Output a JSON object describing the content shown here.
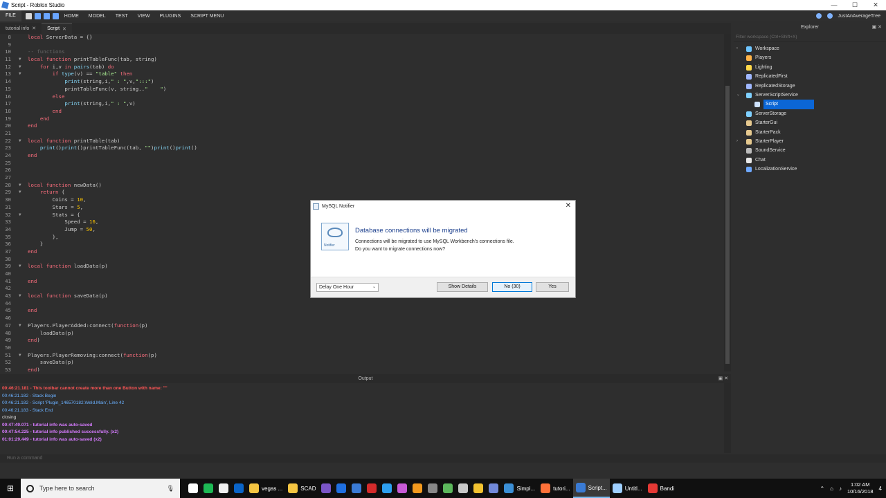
{
  "window": {
    "title": "Script - Roblox Studio"
  },
  "menu": {
    "file": "FILE",
    "tabs": [
      "HOME",
      "MODEL",
      "TEST",
      "VIEW",
      "PLUGINS",
      "SCRIPT MENU"
    ],
    "user": "JustAnAverageTree"
  },
  "doc_tabs": [
    {
      "label": "tutorial info",
      "active": false
    },
    {
      "label": "Script",
      "active": true
    }
  ],
  "code_lines": [
    {
      "n": "8",
      "fold": "",
      "code": "<span class=\"kw\">local</span> ServerData = {}"
    },
    {
      "n": "9",
      "fold": "",
      "code": ""
    },
    {
      "n": "10",
      "fold": "",
      "code": "<span class=\"cm\">-- functions</span>"
    },
    {
      "n": "11",
      "fold": "▼",
      "code": "<span class=\"kw\">local function</span> printTableFunc(tab, string)"
    },
    {
      "n": "12",
      "fold": "▼",
      "code": "    <span class=\"kw\">for</span> i,v <span class=\"kw\">in</span> <span class=\"bi\">pairs</span>(tab) <span class=\"kw\">do</span>"
    },
    {
      "n": "13",
      "fold": "▼",
      "code": "        <span class=\"kw\">if</span> <span class=\"bi\">type</span>(v) == <span class=\"str\">\"table\"</span> <span class=\"kw\">then</span>"
    },
    {
      "n": "14",
      "fold": "",
      "code": "            <span class=\"bi\">print</span>(string,i,<span class=\"str\">\" : \"</span>,v,<span class=\"str\">\":::\"</span>)"
    },
    {
      "n": "15",
      "fold": "",
      "code": "            printTableFunc(v, string..<span class=\"str\">\"    \"</span>)"
    },
    {
      "n": "16",
      "fold": "",
      "code": "        <span class=\"kw\">else</span>"
    },
    {
      "n": "17",
      "fold": "",
      "code": "            <span class=\"bi\">print</span>(string,i,<span class=\"str\">\" : \"</span>,v)"
    },
    {
      "n": "18",
      "fold": "",
      "code": "        <span class=\"kw\">end</span>"
    },
    {
      "n": "19",
      "fold": "",
      "code": "    <span class=\"kw\">end</span>"
    },
    {
      "n": "20",
      "fold": "",
      "code": "<span class=\"kw\">end</span>"
    },
    {
      "n": "21",
      "fold": "",
      "code": ""
    },
    {
      "n": "22",
      "fold": "▼",
      "code": "<span class=\"kw\">local function</span> printTable(tab)"
    },
    {
      "n": "23",
      "fold": "",
      "code": "    <span class=\"bi\">print</span>()<span class=\"bi\">print</span>()printTableFunc(tab, <span class=\"str\">\"\"</span>)<span class=\"bi\">print</span>()<span class=\"bi\">print</span>()"
    },
    {
      "n": "24",
      "fold": "",
      "code": "<span class=\"kw\">end</span>"
    },
    {
      "n": "25",
      "fold": "",
      "code": ""
    },
    {
      "n": "26",
      "fold": "",
      "code": ""
    },
    {
      "n": "27",
      "fold": "",
      "code": ""
    },
    {
      "n": "28",
      "fold": "▼",
      "code": "<span class=\"kw\">local function</span> newData()"
    },
    {
      "n": "29",
      "fold": "▼",
      "code": "    <span class=\"kw\">return</span> {"
    },
    {
      "n": "30",
      "fold": "",
      "code": "        Coins = <span class=\"num\">10</span>,"
    },
    {
      "n": "31",
      "fold": "",
      "code": "        Stars = <span class=\"num\">5</span>,"
    },
    {
      "n": "32",
      "fold": "▼",
      "code": "        Stats = {"
    },
    {
      "n": "33",
      "fold": "",
      "code": "            Speed = <span class=\"num\">16</span>,"
    },
    {
      "n": "34",
      "fold": "",
      "code": "            Jump = <span class=\"num\">50</span>,"
    },
    {
      "n": "35",
      "fold": "",
      "code": "        },"
    },
    {
      "n": "36",
      "fold": "",
      "code": "    }"
    },
    {
      "n": "37",
      "fold": "",
      "code": "<span class=\"kw\">end</span>"
    },
    {
      "n": "38",
      "fold": "",
      "code": ""
    },
    {
      "n": "39",
      "fold": "▼",
      "code": "<span class=\"kw\">local function</span> loadData(p)"
    },
    {
      "n": "40",
      "fold": "",
      "code": ""
    },
    {
      "n": "41",
      "fold": "",
      "code": "<span class=\"kw\">end</span>"
    },
    {
      "n": "42",
      "fold": "",
      "code": ""
    },
    {
      "n": "43",
      "fold": "▼",
      "code": "<span class=\"kw\">local function</span> saveData(p)"
    },
    {
      "n": "44",
      "fold": "",
      "code": ""
    },
    {
      "n": "45",
      "fold": "",
      "code": "<span class=\"kw\">end</span>"
    },
    {
      "n": "46",
      "fold": "",
      "code": ""
    },
    {
      "n": "47",
      "fold": "▼",
      "code": "Players.PlayerAdded:connect(<span class=\"kw\">function</span>(p)"
    },
    {
      "n": "48",
      "fold": "",
      "code": "    loadData(p)"
    },
    {
      "n": "49",
      "fold": "",
      "code": "<span class=\"kw\">end</span>)"
    },
    {
      "n": "50",
      "fold": "",
      "code": ""
    },
    {
      "n": "51",
      "fold": "▼",
      "code": "Players.PlayerRemoving:connect(<span class=\"kw\">function</span>(p)"
    },
    {
      "n": "52",
      "fold": "",
      "code": "    saveData(p)"
    },
    {
      "n": "53",
      "fold": "",
      "code": "<span class=\"kw\">end</span>)"
    }
  ],
  "output": {
    "title": "Output",
    "lines": [
      {
        "text": "00:46:21.181 - This toolbar cannot create more than one Button with name: \"\"",
        "kind": "out-err"
      },
      {
        "text": "00:46:21.182 - Stack Begin",
        "kind": "out-info"
      },
      {
        "text": "00:46:21.182 - Script 'Plugin_146570182.Weld.Main', Line 42",
        "kind": "out-info"
      },
      {
        "text": "00:46:21.183 - Stack End",
        "kind": "out-info"
      },
      {
        "text": "closing",
        "kind": "out-plain"
      },
      {
        "text": "00:47:49.071 - tutorial info was auto-saved",
        "kind": "out-purple"
      },
      {
        "text": "00:47:54.225 - tutorial info published successfully. (x2)",
        "kind": "out-purple"
      },
      {
        "text": "01:01:29.449 - tutorial info was auto-saved (x2)",
        "kind": "out-purple"
      }
    ]
  },
  "command_bar": {
    "placeholder": "Run a command"
  },
  "explorer": {
    "title": "Explorer",
    "filter_placeholder": "Filter workspace (Ctrl+Shift+X)",
    "items": [
      {
        "label": "Workspace",
        "icon": "workspace-icon",
        "color": "#6ec5ff",
        "arrow": "›",
        "indent": 0
      },
      {
        "label": "Players",
        "icon": "players-icon",
        "color": "#ffb347",
        "arrow": "",
        "indent": 0
      },
      {
        "label": "Lighting",
        "icon": "lighting-icon",
        "color": "#ffd84a",
        "arrow": "",
        "indent": 0
      },
      {
        "label": "ReplicatedFirst",
        "icon": "replicatedfirst-icon",
        "color": "#9fb7ff",
        "arrow": "",
        "indent": 0
      },
      {
        "label": "ReplicatedStorage",
        "icon": "replicatedstorage-icon",
        "color": "#9fb7ff",
        "arrow": "",
        "indent": 0
      },
      {
        "label": "ServerScriptService",
        "icon": "serverscriptservice-icon",
        "color": "#7fd0ff",
        "arrow": "⌄",
        "indent": 0
      },
      {
        "label": "Script",
        "icon": "script-icon",
        "color": "#cfe3ff",
        "arrow": "",
        "indent": 1,
        "selected": true
      },
      {
        "label": "ServerStorage",
        "icon": "serverstorage-icon",
        "color": "#7fd0ff",
        "arrow": "",
        "indent": 0
      },
      {
        "label": "StarterGui",
        "icon": "startergui-icon",
        "color": "#e6c98f",
        "arrow": "",
        "indent": 0
      },
      {
        "label": "StarterPack",
        "icon": "starterpack-icon",
        "color": "#e6c98f",
        "arrow": "",
        "indent": 0
      },
      {
        "label": "StarterPlayer",
        "icon": "starterplayer-icon",
        "color": "#e6c98f",
        "arrow": "›",
        "indent": 0
      },
      {
        "label": "SoundService",
        "icon": "soundservice-icon",
        "color": "#bbbbbb",
        "arrow": "",
        "indent": 0
      },
      {
        "label": "Chat",
        "icon": "chat-icon",
        "color": "#e8e8e8",
        "arrow": "",
        "indent": 0
      },
      {
        "label": "LocalizationService",
        "icon": "localization-icon",
        "color": "#6ea8ff",
        "arrow": "",
        "indent": 0
      }
    ]
  },
  "dialog": {
    "title": "MySQL Notifier",
    "heading": "Database connections will be migrated",
    "message_line1": "Connections will be migrated to use MySQL Workbench's connections file.",
    "message_line2": "Do you want to migrate connections now?",
    "icon_label": "Notifier",
    "select_value": "Delay One Hour",
    "show_details": "Show Details",
    "no_button": "No (30)",
    "yes_button": "Yes"
  },
  "taskbar": {
    "search_placeholder": "Type here to search",
    "items": [
      {
        "label": "",
        "icon": "task-view-icon",
        "color": "#ffffff"
      },
      {
        "label": "",
        "icon": "spotify-icon",
        "color": "#1db954"
      },
      {
        "label": "",
        "icon": "itunes-icon",
        "color": "#f0f0f0"
      },
      {
        "label": "",
        "icon": "outlook-icon",
        "color": "#0a64c8"
      },
      {
        "label": "vegas ...",
        "icon": "folder-icon",
        "color": "#f5c542"
      },
      {
        "label": "SCAD",
        "icon": "folder-icon",
        "color": "#f5c542"
      },
      {
        "label": "",
        "icon": "visual-studio-icon",
        "color": "#7b55c7"
      },
      {
        "label": "",
        "icon": "live-icon",
        "color": "#1f6fe0"
      },
      {
        "label": "",
        "icon": "roblox-studio-icon",
        "color": "#3a7bd5"
      },
      {
        "label": "",
        "icon": "red-app-icon",
        "color": "#d42b2b"
      },
      {
        "label": "",
        "icon": "photoshop-icon",
        "color": "#2da0f0"
      },
      {
        "label": "",
        "icon": "premiere-icon",
        "color": "#c85ad6"
      },
      {
        "label": "",
        "icon": "illustrator-icon",
        "color": "#f39a1e"
      },
      {
        "label": "",
        "icon": "camera-icon",
        "color": "#888888"
      },
      {
        "label": "",
        "icon": "green-app-icon",
        "color": "#5cb85c"
      },
      {
        "label": "",
        "icon": "steam-icon",
        "color": "#c8c8c8"
      },
      {
        "label": "",
        "icon": "chrome-icon",
        "color": "#f2c230"
      },
      {
        "label": "",
        "icon": "discord-icon",
        "color": "#7289da"
      },
      {
        "label": "Simpl...",
        "icon": "simplenote-icon",
        "color": "#3b8fd6"
      },
      {
        "label": "tutori...",
        "icon": "firefox-icon",
        "color": "#ff7139"
      },
      {
        "label": "Script...",
        "icon": "roblox-studio-icon",
        "color": "#3a7bd5",
        "active": true
      },
      {
        "label": "Untitl...",
        "icon": "notepad-icon",
        "color": "#9ecfff"
      },
      {
        "label": "Bandi",
        "icon": "bandicam-icon",
        "color": "#e53935"
      }
    ],
    "time": "1:02 AM",
    "date": "10/16/2018",
    "notifications": "4"
  }
}
